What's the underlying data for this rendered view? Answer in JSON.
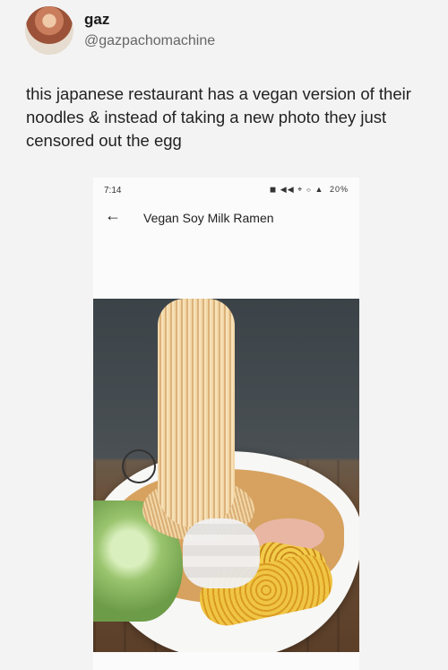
{
  "tweet": {
    "name": "gaz",
    "handle": "@gazpachomachine",
    "text": "this japanese restaurant has a vegan version of their noodles & instead of taking a new photo they just censored out the egg"
  },
  "phone": {
    "status": {
      "time": "7:14",
      "icons": "◼ ◀◀ ⌖ ⌔ ▲",
      "battery": "20%"
    },
    "appbar": {
      "back_icon": "←",
      "title": "Vegan Soy Milk Ramen"
    }
  }
}
